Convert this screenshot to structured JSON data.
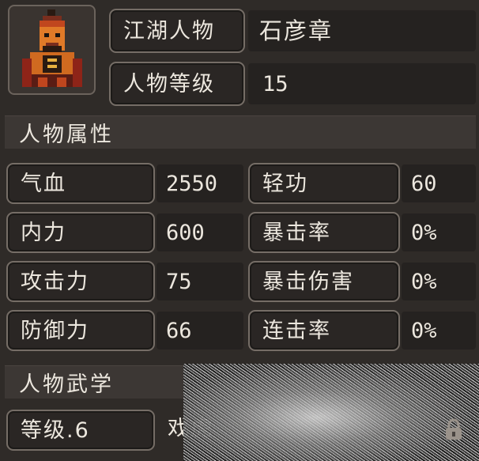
{
  "header": {
    "name_label": "江湖人物",
    "name_value": "石彦章",
    "level_label": "人物等级",
    "level_value": "15"
  },
  "sections": {
    "attributes": "人物属性",
    "martial": "人物武学"
  },
  "stats": [
    {
      "label": "气血",
      "value": "2550"
    },
    {
      "label": "内力",
      "value": "600"
    },
    {
      "label": "攻击力",
      "value": "75"
    },
    {
      "label": "防御力",
      "value": "66"
    }
  ],
  "stats_right": [
    {
      "label": "轻功",
      "value": "60"
    },
    {
      "label": "暴击率",
      "value": "0%"
    },
    {
      "label": "暴击伤害",
      "value": "0%"
    },
    {
      "label": "连击率",
      "value": "0%"
    }
  ],
  "martial": {
    "level_label": "等级.6",
    "skill_name": "戏虎"
  },
  "icons": {
    "portrait": "warrior-portrait-icon",
    "lock": "lock-icon"
  }
}
